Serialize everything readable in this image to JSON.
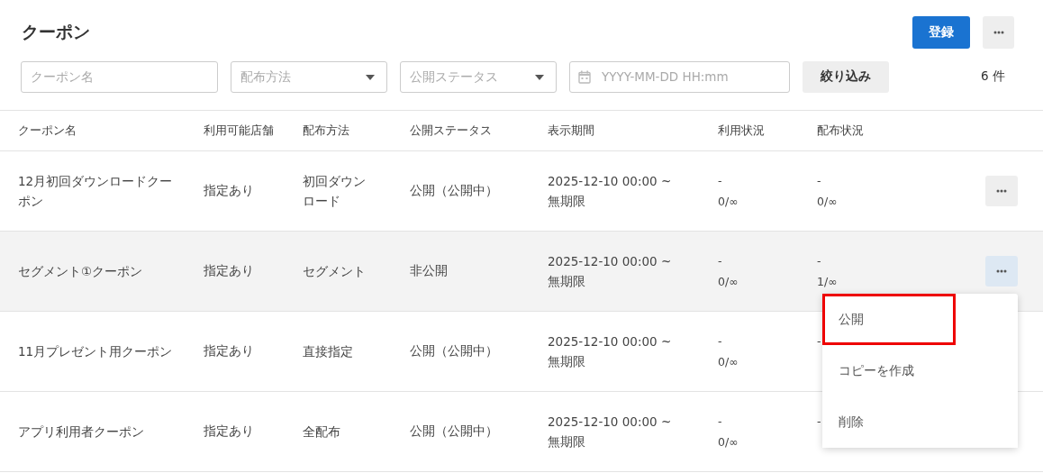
{
  "page": {
    "title": "クーポン",
    "register_button": "登録"
  },
  "filters": {
    "name_field": {
      "placeholder": "クーポン名"
    },
    "method_select": {
      "placeholder": "配布方法"
    },
    "status_select": {
      "placeholder": "公開ステータス"
    },
    "date_field": {
      "placeholder": "YYYY-MM-DD HH:mm"
    },
    "filter_button": "絞り込み",
    "count": "6 件"
  },
  "table": {
    "columns": [
      "クーポン名",
      "利用可能店舗",
      "配布方法",
      "公開ステータス",
      "表示期間",
      "利用状況",
      "配布状況"
    ],
    "rows": [
      {
        "name": "12月初回ダウンロードクーポン",
        "stores": "指定あり",
        "method": "初回ダウンロード",
        "status": "公開（公開中）",
        "period": "2025-12-10 00:00 ~",
        "period_end": "無期限",
        "usage": "-",
        "usage_count": "0/∞",
        "distribution": "-",
        "distribution_count": "0/∞",
        "more_button": true,
        "selected": false
      },
      {
        "name": "セグメント①クーポン",
        "stores": "指定あり",
        "method": "セグメント",
        "status": "非公開",
        "period": "2025-12-10 00:00 ~",
        "period_end": "無期限",
        "usage": "-",
        "usage_count": "0/∞",
        "distribution": "-",
        "distribution_count": "1/∞",
        "more_button": true,
        "selected": true
      },
      {
        "name": "11月プレゼント用クーポン",
        "stores": "指定あり",
        "method": "直接指定",
        "status": "公開（公開中）",
        "period": "2025-12-10 00:00 ~",
        "period_end": "無期限",
        "usage": "-",
        "usage_count": "0/∞",
        "distribution": "-",
        "more_button": false,
        "selected": false
      },
      {
        "name": "アプリ利用者クーポン",
        "stores": "指定あり",
        "method": "全配布",
        "status": "公開（公開中）",
        "period": "2025-12-10 00:00 ~",
        "period_end": "無期限",
        "usage": "-",
        "usage_count": "0/∞",
        "distribution": "-",
        "more_button": false,
        "selected": false
      }
    ]
  },
  "action_menu": {
    "items": [
      {
        "label": "公開",
        "highlighted": true
      },
      {
        "label": "コピーを作成",
        "highlighted": false
      },
      {
        "label": "削除",
        "highlighted": false
      }
    ]
  }
}
